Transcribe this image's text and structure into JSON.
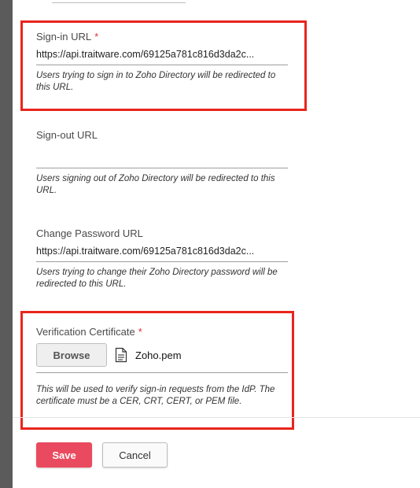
{
  "signin": {
    "label": "Sign-in URL",
    "required_mark": "*",
    "value": "https://api.traitware.com/69125a781c816d3da2c...",
    "help": "Users trying to sign in to Zoho Directory will be redirected to this URL."
  },
  "signout": {
    "label": "Sign-out URL",
    "value": "",
    "help": "Users signing out of Zoho Directory will be redirected to this URL."
  },
  "change_password": {
    "label": "Change Password URL",
    "value": "https://api.traitware.com/69125a781c816d3da2c...",
    "help": "Users trying to change their Zoho Directory password will be redirected to this URL."
  },
  "certificate": {
    "label": "Verification Certificate",
    "required_mark": "*",
    "browse_label": "Browse",
    "file_name": "Zoho.pem",
    "file_icon": "document-icon",
    "help": "This will be used to verify sign-in requests from the IdP. The certificate must be a CER, CRT, CERT, or PEM file."
  },
  "actions": {
    "save_label": "Save",
    "cancel_label": "Cancel"
  },
  "colors": {
    "highlight": "#e8251c",
    "save_button": "#ea4a5f",
    "required": "#e03131"
  }
}
